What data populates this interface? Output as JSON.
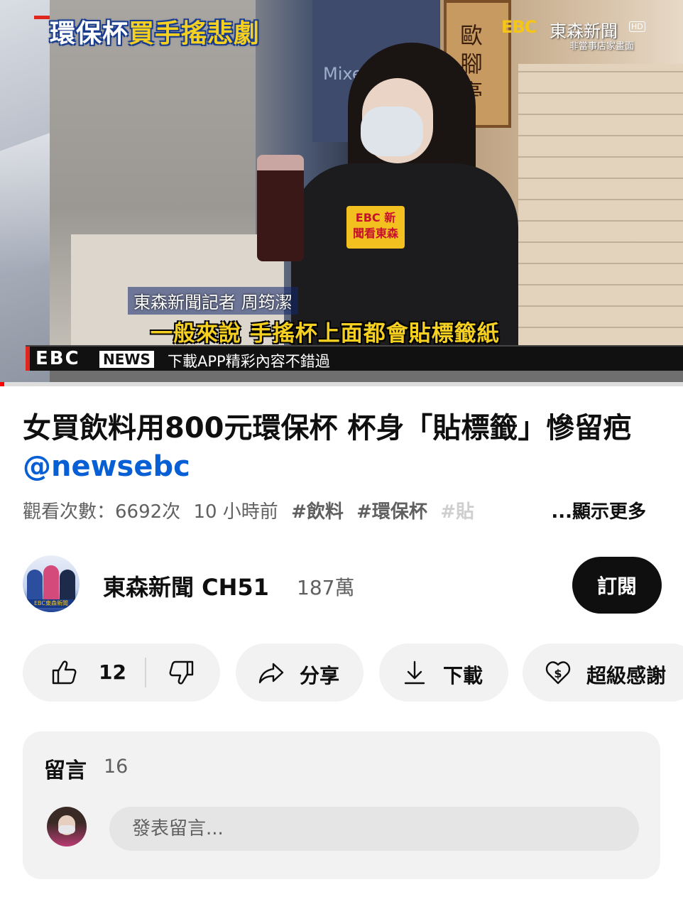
{
  "video": {
    "headline_part1": "環保杯",
    "headline_part2": "買手搖悲劇",
    "brand_logo": "EBC",
    "brand_name": "東森新聞",
    "brand_hd": "HD",
    "brand_note": "非當事店家畫面",
    "scene_sign": "歐腳亭",
    "scene_tv_text": "Mixed Berr Gre",
    "mic_label": "EBC 新聞看東森",
    "reporter_caption": "東森新聞記者 周筠潔",
    "subtitle": "一般來說 手搖杯上面都會貼標籤紙",
    "ticker_logo": "EBC",
    "ticker_news": "NEWS",
    "ticker_text": "下載APP精彩內容不錯過",
    "progress_fraction": 0.004
  },
  "title": {
    "text": "女買飲料用800元環保杯 杯身「貼標籤」慘留疤 ",
    "handle": "@newsebc"
  },
  "meta": {
    "views": "觀看次數：6692次",
    "time": "10 小時前",
    "tags": [
      "#飲料",
      "#環保杯",
      "#貼"
    ],
    "more": "...顯示更多"
  },
  "channel": {
    "name": "東森新聞 CH51",
    "subscribers": "187萬",
    "avatar_band": "EBC東森新聞",
    "subscribe_label": "訂閱"
  },
  "actions": {
    "like_count": "12",
    "share_label": "分享",
    "download_label": "下載",
    "thanks_label": "超級感謝"
  },
  "comments": {
    "title": "留言",
    "count": "16",
    "placeholder": "發表留言..."
  },
  "colors": {
    "accent": "#065fd4",
    "progress": "#ff0000",
    "subtitle": "#f5d020"
  }
}
